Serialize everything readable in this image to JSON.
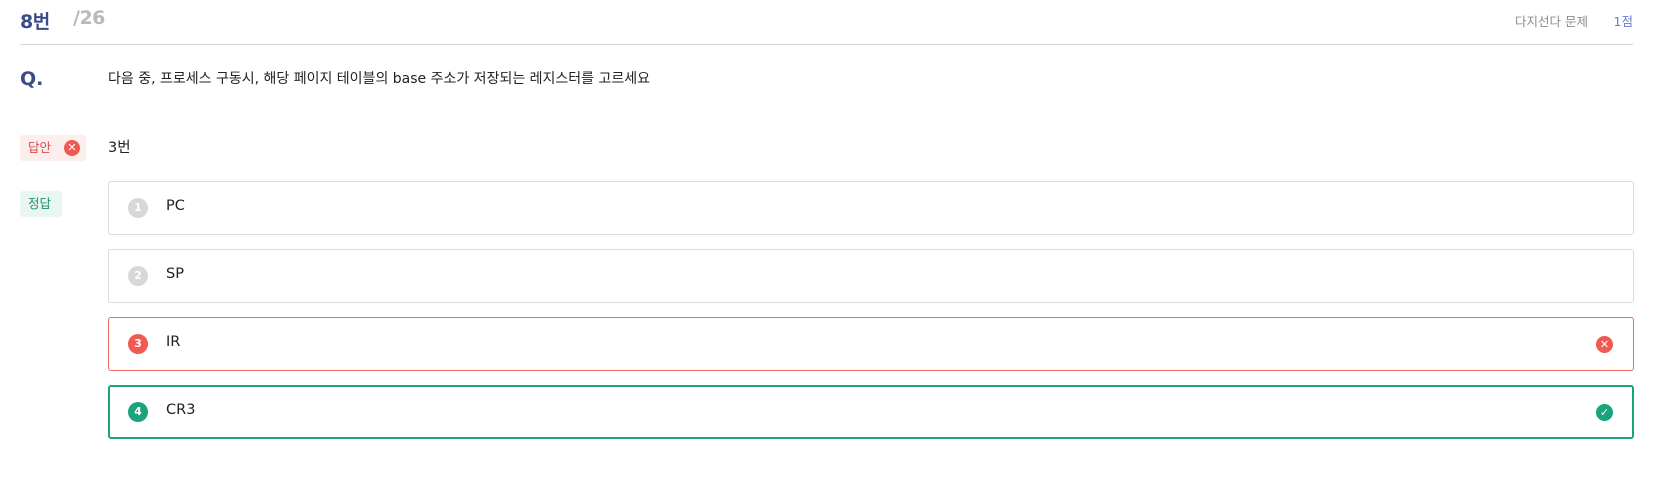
{
  "header": {
    "question_number": "8번",
    "question_total": "/26",
    "question_type": "다지선다 문제",
    "score": "1점"
  },
  "question": {
    "marker": "Q.",
    "text": "다음 중, 프로세스 구동시, 해당 페이지 테이블의 base 주소가 저장되는 레지스터를 고르세요"
  },
  "answer": {
    "label": "답안",
    "status_icon": "x-circle-icon",
    "value": "3번"
  },
  "correct": {
    "label": "정답"
  },
  "options": [
    {
      "number": "1",
      "label": "PC"
    },
    {
      "number": "2",
      "label": "SP"
    },
    {
      "number": "3",
      "label": "IR",
      "state": "wrong",
      "icon": "x-circle-icon"
    },
    {
      "number": "4",
      "label": "CR3",
      "state": "correct",
      "icon": "check-circle-icon"
    }
  ],
  "colors": {
    "accent": "#3b4a8a",
    "wrong": "#ef5a52",
    "correct": "#1aa37d",
    "score": "#6b7bd6"
  }
}
